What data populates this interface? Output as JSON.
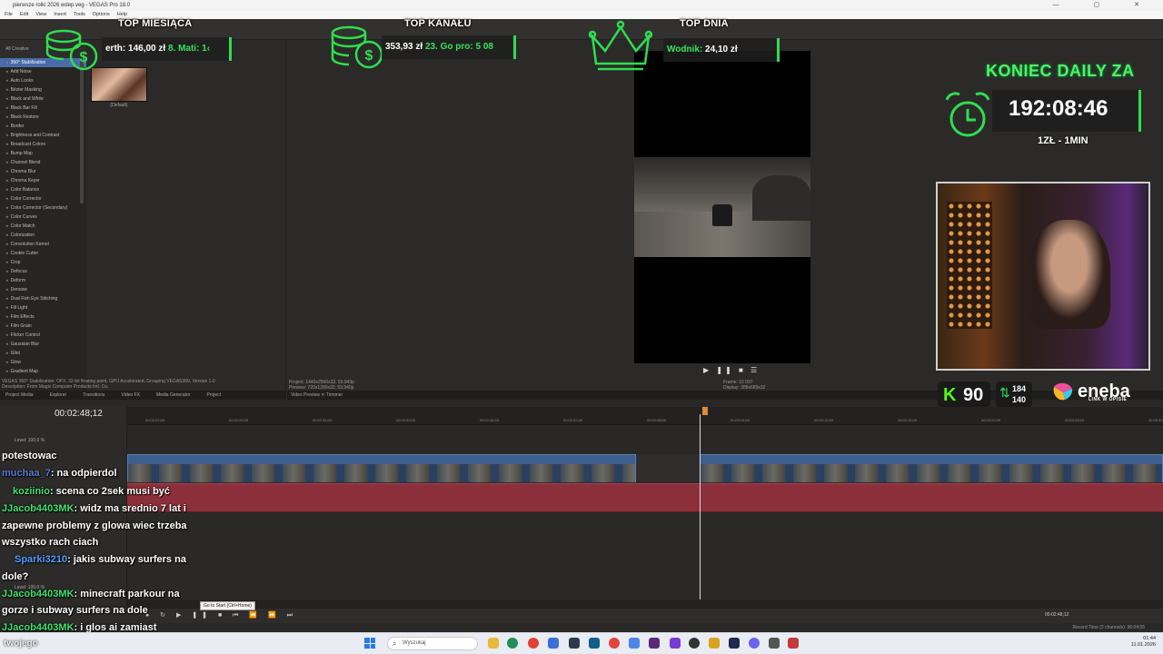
{
  "window": {
    "title": "pierwsze rolki 2026 wdep.veg - VEGAS Pro 18.0"
  },
  "menu": [
    "File",
    "Edit",
    "View",
    "Insert",
    "Tools",
    "Options",
    "Help"
  ],
  "fx_panel": {
    "tabs": "All   Creative",
    "items": [
      "360° Stabilization",
      "Add Noise",
      "Auto Looks",
      "Bézier Masking",
      "Black and White",
      "Black Bar Fill",
      "Black Restore",
      "Border",
      "Brightness and Contrast",
      "Broadcast Colors",
      "Bump Map",
      "Channel Blend",
      "Chroma Blur",
      "Chroma Keyer",
      "Color Balance",
      "Color Corrector",
      "Color Corrector (Secondary)",
      "Color Curves",
      "Color Match",
      "Colorization",
      "Convolution Kernel",
      "Cookie Cutter",
      "Crop",
      "Defocus",
      "Deform",
      "Denoise",
      "Dual Fish Eye Stitching",
      "Fill Light",
      "Film Effects",
      "Film Grain",
      "Flicker Control",
      "Gaussian Blur",
      "Glint",
      "Glow",
      "Gradient Map"
    ],
    "selected_index": 0,
    "preset_label": "(Default)",
    "description": "VEGAS 360° Stabilization: OFX, 32-bit floating point, GPU Accelerated, Grouping VEGAS360, Version 1.0",
    "description2": "Description: From Magix Computer Products Intl. Co.",
    "dock_tabs": [
      "Project Media",
      "Explorer",
      "Transitions",
      "Video FX",
      "Media Generator",
      "Project"
    ]
  },
  "preview": {
    "project_line": "Project:   1440x2560x32; 59,940p",
    "preview_line": "Preview:   720x1280x32; 59,940p",
    "frame_line": "Frame:      10 097",
    "display_line": "Display:    388x689x32",
    "dock_tabs": "Video Preview   ✕   Trimmer"
  },
  "timeline": {
    "timecode": "00:02:48;12",
    "level1": "Level: 100,0 %",
    "level2": "Level: 100,0 %",
    "ruler": [
      "00:02:22;09",
      "00:02:28;09",
      "00:02:34;09",
      "00:02:40;09",
      "00:02:46;09",
      "00:02:52;09",
      "00:02:58;09",
      "00:03:04;09",
      "00:03:10;09",
      "00:03:16;09",
      "00:03:22;09",
      "00:03:28;09",
      "00:03:34;09"
    ],
    "tooltip": "Go to Start (Ctrl+Home)",
    "end_timecode": "00:02:48;12",
    "status": "Record Time (2 channels): 36:04:55"
  },
  "overlays": {
    "top_month": {
      "title": "TOP MIESIĄCA",
      "name": "erth:",
      "amount": "146,00 zł",
      "second": "8. Mati: 1‹"
    },
    "top_channel": {
      "title": "TOP KANAŁU",
      "amount": "353,93 zł",
      "second": "23. Go pro: 5 08"
    },
    "top_day": {
      "title": "TOP DNIA",
      "name": "Wodnik:",
      "amount": "24,10 zł"
    },
    "countdown_title": "KONIEC DAILY ZA",
    "countdown": "192:08:46",
    "rate": "1ZŁ - 1MIN",
    "kick_count": "90",
    "stat_top": "184",
    "stat_bottom": "140",
    "sponsor": "eneba",
    "sponsor_sub": "LINK W OPISIE"
  },
  "chat": [
    {
      "user": "",
      "text": "potestowac",
      "color": "#ffffff"
    },
    {
      "user": "muchaa_7",
      "text": ": na odpierdol",
      "color": "#5b79d6"
    },
    {
      "user": "koziinio",
      "text": ": scena co 2sek musi być",
      "color": "#3fe26e"
    },
    {
      "user": "JJacob4403MK",
      "text": ": widz ma srednio 7 lat i",
      "color": "#3fe26e"
    },
    {
      "user": "",
      "text": "zapewne problemy z glowa wiec trzeba",
      "color": "#ffffff"
    },
    {
      "user": "",
      "text": "wszystko rach ciach",
      "color": "#ffffff"
    },
    {
      "user": "Sparki3210",
      "text": ": jakis subway surfers na",
      "color": "#4fa0ff"
    },
    {
      "user": "",
      "text": "dole?",
      "color": "#ffffff"
    },
    {
      "user": "JJacob4403MK",
      "text": ": minecraft parkour na",
      "color": "#3fe26e"
    },
    {
      "user": "",
      "text": "gorze i subway surfers na dole",
      "color": "#ffffff"
    },
    {
      "user": "JJacob4403MK",
      "text": ": i glos ai zamiast",
      "color": "#3fe26e"
    },
    {
      "user": "",
      "text": "twojego",
      "color": "#ffffff"
    }
  ],
  "taskbar": {
    "search_placeholder": "Wyszukaj",
    "time": "01:44",
    "date": "11.01.2026"
  },
  "colors": {
    "accent_green": "#2ede4f",
    "track_red": "#8b2f3a",
    "clip_blue": "#3c5f8e"
  }
}
